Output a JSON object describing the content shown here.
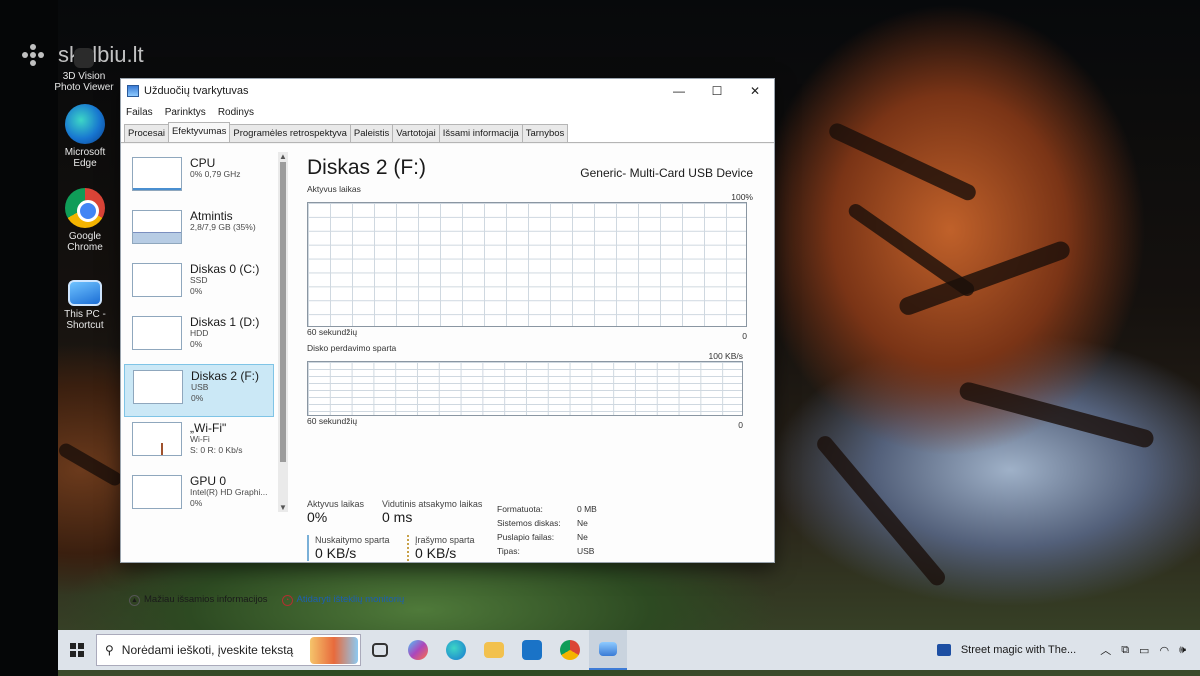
{
  "watermark": "skelbiu.lt",
  "desktop_icons": {
    "viewer": "3D Vision Photo Viewer",
    "edge": "Microsoft Edge",
    "chrome": "Google Chrome",
    "pc": "This PC - Shortcut"
  },
  "window": {
    "title": "Užduočių tvarkytuvas",
    "menu": [
      "Failas",
      "Parinktys",
      "Rodinys"
    ],
    "tabs": [
      "Procesai",
      "Efektyvumas",
      "Programėles retrospektyva",
      "Paleistis",
      "Vartotojai",
      "Išsami informacija",
      "Tarnybos"
    ],
    "active_tab": "Efektyvumas"
  },
  "sidebar": [
    {
      "name": "CPU",
      "line1": "0% 0,79 GHz",
      "line2": ""
    },
    {
      "name": "Atmintis",
      "line1": "2,8/7,9 GB (35%)",
      "line2": ""
    },
    {
      "name": "Diskas 0 (C:)",
      "line1": "SSD",
      "line2": "0%"
    },
    {
      "name": "Diskas 1 (D:)",
      "line1": "HDD",
      "line2": "0%"
    },
    {
      "name": "Diskas 2 (F:)",
      "line1": "USB",
      "line2": "0%"
    },
    {
      "name": "„Wi-Fi\"",
      "line1": "Wi-Fi",
      "line2": "S: 0 R: 0 Kb/s"
    },
    {
      "name": "GPU 0",
      "line1": "Intel(R) HD Graphi...",
      "line2": "0%"
    }
  ],
  "selected_item": "Diskas 2 (F:)",
  "detail": {
    "title": "Diskas 2 (F:)",
    "device": "Generic- Multi-Card USB Device",
    "graph1": {
      "label": "Aktyvus laikas",
      "max": "100%",
      "time": "60 sekundžių",
      "min": "0"
    },
    "graph2": {
      "label": "Disko perdavimo sparta",
      "max": "100 KB/s",
      "time": "60 sekundžių",
      "min": "0"
    }
  },
  "stats": {
    "active_label": "Aktyvus laikas",
    "active_value": "0%",
    "response_label": "Vidutinis atsakymo laikas",
    "response_value": "0 ms",
    "read_label": "Nuskaitymo sparta",
    "read_value": "0 KB/s",
    "write_label": "Įrašymo sparta",
    "write_value": "0 KB/s"
  },
  "properties": [
    {
      "key": "Formatuota:",
      "value": "0 MB"
    },
    {
      "key": "Sistemos diskas:",
      "value": "Ne"
    },
    {
      "key": "Puslapio failas:",
      "value": "Ne"
    },
    {
      "key": "Tipas:",
      "value": "USB"
    }
  ],
  "footer": {
    "less_details": "Mažiau išsamios informacijos",
    "resource_monitor": "Atidaryti išteklių monitorių"
  },
  "taskbar": {
    "search_placeholder": "Norėdami ieškoti, įveskite tekstą",
    "media": "Street magic with The..."
  },
  "colors": {
    "accent_selected": "#cbe8f6",
    "taskbar": "#dde3ea",
    "link": "#1d5fb0"
  }
}
